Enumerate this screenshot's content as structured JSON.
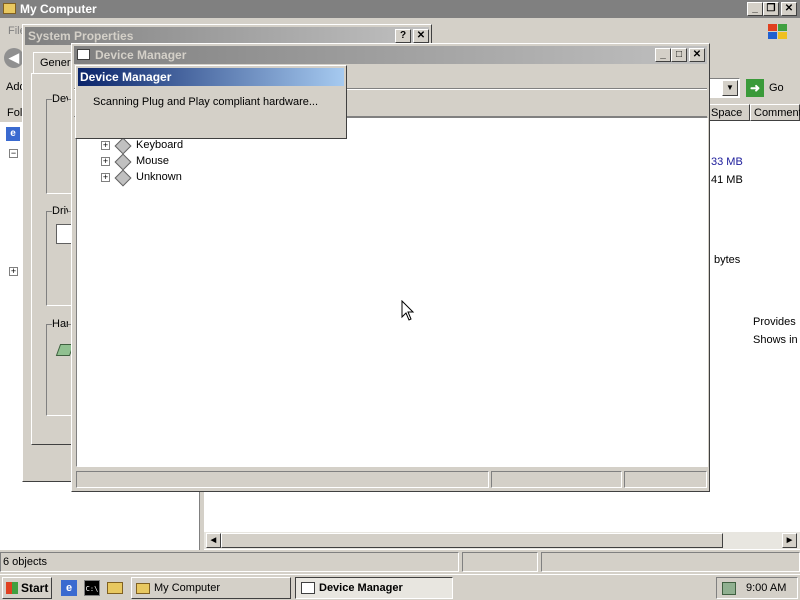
{
  "explorer": {
    "title": "My Computer",
    "menu_first": "File",
    "address_label": "Address",
    "folders_label": "Folders",
    "go_label": "Go",
    "columns": [
      "Space",
      "Comment"
    ],
    "values": [
      "33 MB",
      "41 MB"
    ],
    "bytes_text": "bytes",
    "comments": [
      "Provides",
      "Shows in"
    ],
    "status_objects": "6 objects"
  },
  "system_properties": {
    "title": "System Properties",
    "tab_general": "General",
    "group_device": "Device Manager",
    "group_drivers": "Drivers",
    "group_hardware": "Hardware Profiles"
  },
  "device_manager": {
    "title": "Device Manager",
    "tree": [
      {
        "label": "Keyboard"
      },
      {
        "label": "Mouse"
      },
      {
        "label": "Unknown"
      }
    ]
  },
  "scan_dialog": {
    "title": "Device Manager",
    "message": "Scanning Plug and Play compliant hardware..."
  },
  "taskbar": {
    "start_label": "Start",
    "tasks": [
      {
        "label": "My Computer",
        "active": false
      },
      {
        "label": "Device Manager",
        "active": true
      }
    ],
    "clock": "9:00 AM"
  }
}
